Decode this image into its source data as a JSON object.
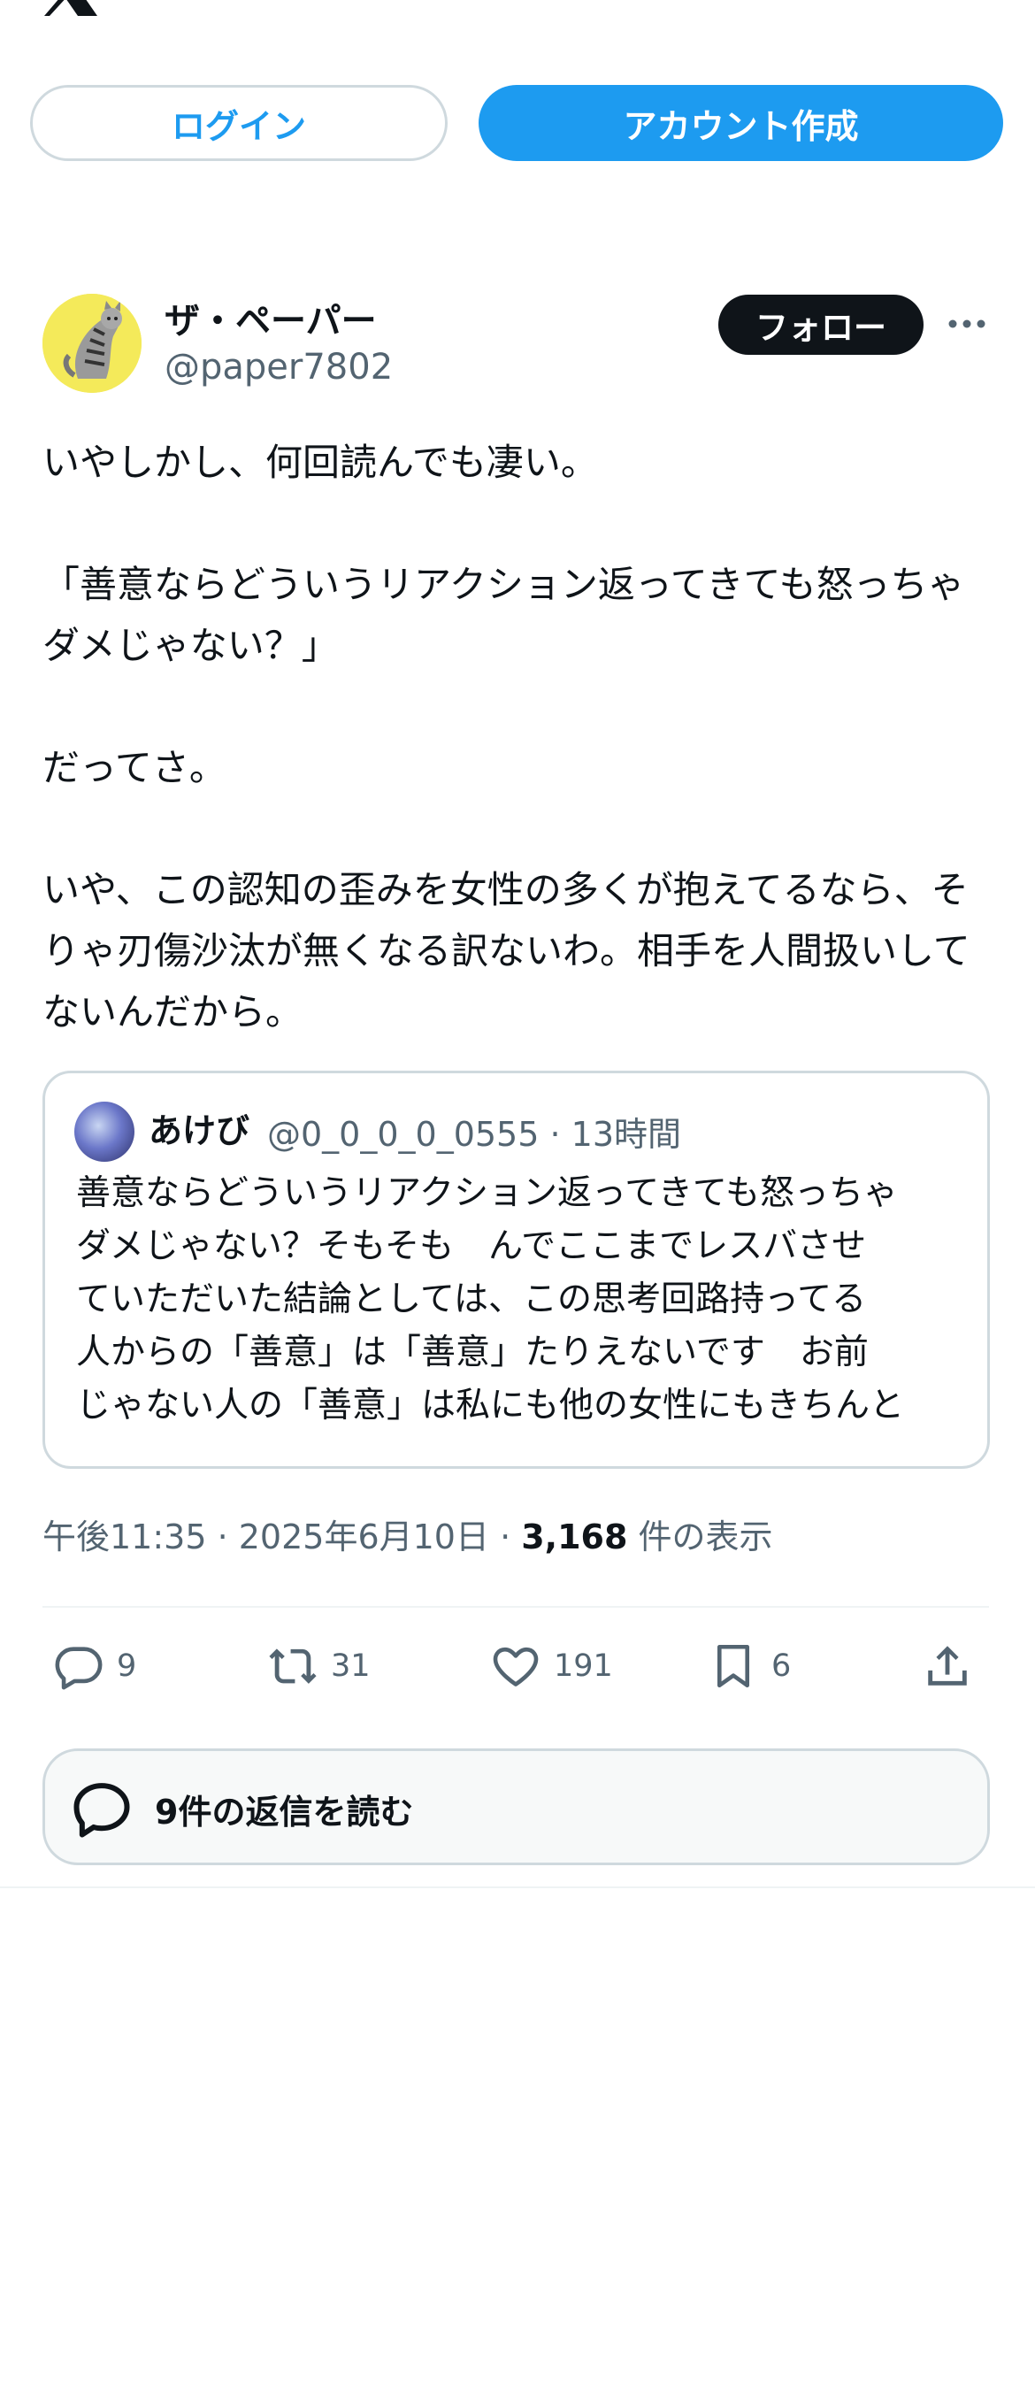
{
  "header": {
    "logo_icon": "x-logo-icon"
  },
  "auth": {
    "login_label": "ログイン",
    "signup_label": "アカウント作成"
  },
  "post": {
    "author_name": "ザ・ペーパー",
    "author_handle": "@paper7802",
    "follow_label": "フォロー",
    "text": "いやしかし、何回読んでも凄い。\n\n「善意ならどういうリアクション返ってきても怒っちゃダメじゃない？」\n\nだってさ。\n\nいや、この認知の歪みを女性の多くが抱えてるなら、そりゃ刃傷沙汰が無くなる訳ないわ。相手を人間扱いしてないんだから。",
    "quote": {
      "name": "あけび",
      "handle": "@0_0_0_0_0555 · 13時間",
      "lines": [
        "善意ならどういうリアクション返ってきても怒っちゃ",
        "ダメじゃない？そもそも　んでここまでレスバさせ",
        "ていただいた結論としては、この思考回路持ってる",
        "人からの「善意」は「善意」たりえないです　お前",
        "じゃない人の「善意」は私にも他の女性にもきちんと"
      ]
    },
    "time_date": "午後11:35 · 2025年6月10日 · ",
    "views_count": "3,168",
    "views_label": " 件の表示",
    "actions": {
      "replies": "9",
      "reposts": "31",
      "likes": "191",
      "bookmarks": "6"
    },
    "read_replies_label": "9件の返信を読む"
  },
  "colors": {
    "accent": "#1d9bf0",
    "text": "#0f1419",
    "muted": "#536471",
    "border": "#cfd9de"
  }
}
